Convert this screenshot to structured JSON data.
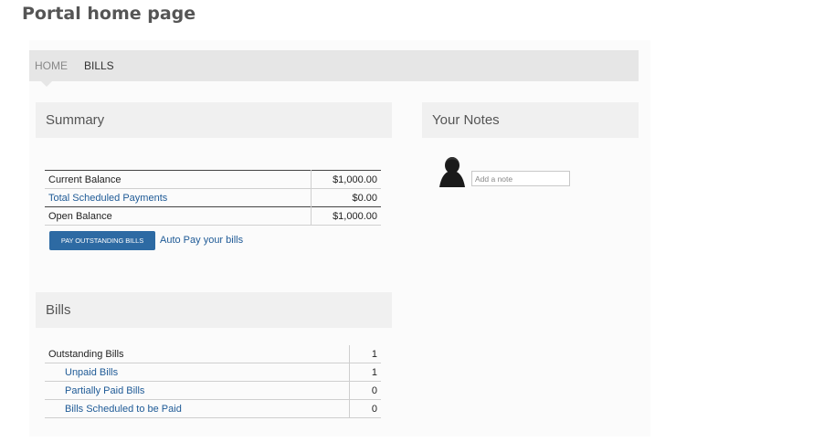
{
  "page_heading": "Portal home page",
  "nav": {
    "home": "HOME",
    "bills": "BILLS"
  },
  "summary": {
    "title": "Summary",
    "rows": [
      {
        "label": "Current Balance",
        "value": "$1,000.00"
      },
      {
        "label": "Total Scheduled Payments",
        "value": "$0.00"
      },
      {
        "label": "Open Balance",
        "value": "$1,000.00"
      }
    ],
    "pay_button": "PAY OUTSTANDING BILLS",
    "autopay_link": "Auto Pay your bills"
  },
  "notes": {
    "title": "Your Notes",
    "placeholder": "Add a note",
    "avatar_icon": "user-silhouette-icon"
  },
  "bills": {
    "title": "Bills",
    "rows": [
      {
        "label": "Outstanding Bills",
        "value": "1"
      },
      {
        "label": "Unpaid Bills",
        "value": "1"
      },
      {
        "label": "Partially Paid Bills",
        "value": "0"
      },
      {
        "label": "Bills Scheduled to be Paid",
        "value": "0"
      }
    ]
  },
  "colors": {
    "link": "#1e5a96",
    "button": "#2d6aa3",
    "navbar": "#e6e6e6"
  }
}
